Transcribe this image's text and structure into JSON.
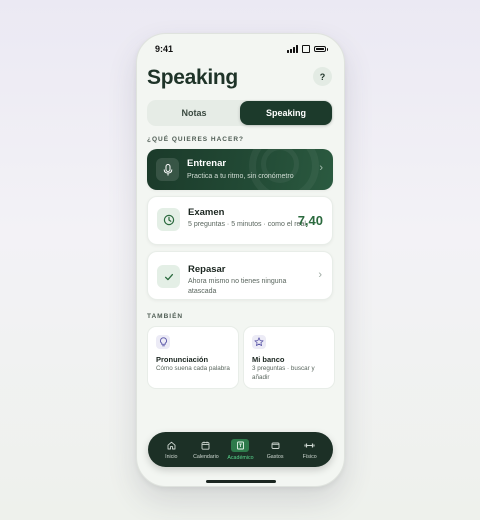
{
  "status_bar": {
    "time": "9:41"
  },
  "header": {
    "title": "Speaking",
    "help_label": "?"
  },
  "tabs": [
    {
      "label": "Notas",
      "active": false
    },
    {
      "label": "Speaking",
      "active": true
    }
  ],
  "sections": {
    "primary": "¿QUÉ QUIERES HACER?",
    "secondary": "TAMBIÉN"
  },
  "actions": {
    "train": {
      "title": "Entrenar",
      "subtitle": "Practica a tu ritmo, sin cronómetro",
      "icon": "microphone-icon"
    },
    "exam": {
      "title": "Examen",
      "subtitle": "5 preguntas · 5 minutos · como el real",
      "score": "7,40",
      "icon": "clock-icon"
    },
    "review": {
      "title": "Repasar",
      "subtitle": "Ahora mismo no tienes ninguna atascada",
      "icon": "check-icon"
    }
  },
  "extras": {
    "pronunciation": {
      "title": "Pronunciación",
      "subtitle": "Cómo suena cada palabra",
      "icon": "lightbulb-icon"
    },
    "bank": {
      "title": "Mi banco",
      "subtitle": "3 preguntas · buscar y añadir",
      "icon": "star-icon"
    }
  },
  "nav": [
    {
      "label": "Inicio",
      "icon": "home-icon",
      "active": false
    },
    {
      "label": "Calendario",
      "icon": "calendar-icon",
      "active": false
    },
    {
      "label": "Académico",
      "icon": "book-icon",
      "active": true
    },
    {
      "label": "Gastos",
      "icon": "wallet-icon",
      "active": false
    },
    {
      "label": "Físico",
      "icon": "dumbbell-icon",
      "active": false
    }
  ],
  "colors": {
    "primary_dark": "#1c3a2b",
    "score_green": "#2b6a3e",
    "nav_active": "#58d68d",
    "background": "#f3f6f2"
  }
}
